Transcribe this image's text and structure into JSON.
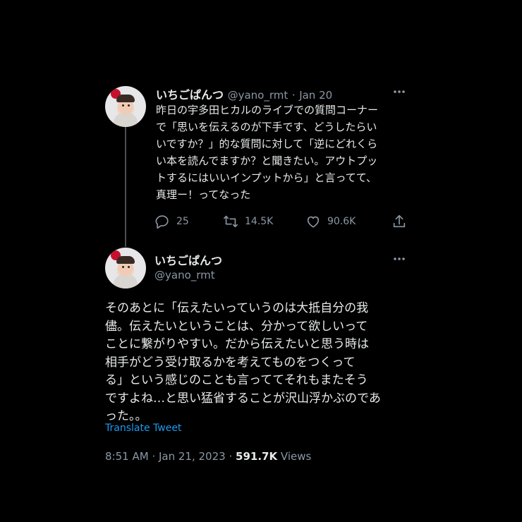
{
  "tweet1": {
    "display_name": "いちごぱんつ",
    "handle": "@yano_rmt",
    "separator": "·",
    "date": "Jan 20",
    "more_icon": "more-horizontal-icon",
    "text": "昨日の宇多田ヒカルのライブでの質問コーナー\nで「思いを伝えるのが下手です、どうしたらい\nいですか？」的な質問に対して「逆にどれくら\nい本を読んでますか？と聞きたい。アウトプッ\nトするにはいいインプットから」と言ってて、\n真理ー！ってなった",
    "actions": {
      "reply_count": "25",
      "retweet_count": "14.5K",
      "like_count": "90.6K",
      "reply_icon": "reply-icon",
      "retweet_icon": "retweet-icon",
      "like_icon": "heart-icon",
      "share_icon": "share-icon"
    }
  },
  "tweet2": {
    "display_name": "いちごぱんつ",
    "handle": "@yano_rmt",
    "more_icon": "more-horizontal-icon",
    "text": "そのあとに「伝えたいっていうのは大抵自分の我\n儘。伝えたいということは、分かって欲しいって\nことに繋がりやすい。だから伝えたいと思う時は\n相手がどう受け取るかを考えてものをつくって\nる」という感じのことも言っててそれもまたそう\nですよね…と思い猛省することが沢山浮かぶのであ\nった。。",
    "translate_label": "Translate Tweet",
    "time": "8:51 AM",
    "separator": "·",
    "date": "Jan 21, 2023",
    "views_count": "591.7K",
    "views_label": "Views"
  },
  "colors": {
    "background": "#000000",
    "primary_text": "#e7e9ea",
    "secondary_text": "#8b98a5",
    "link": "#1d9bf0",
    "thread_line": "#4a4f54"
  }
}
